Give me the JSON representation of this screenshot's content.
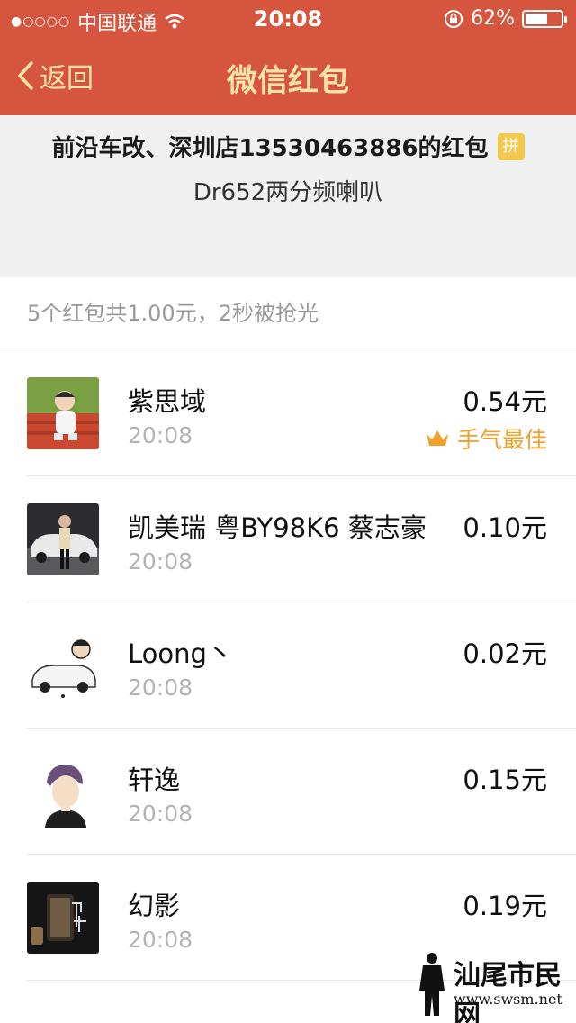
{
  "status_bar": {
    "carrier": "中国联通",
    "time": "20:08",
    "battery": "62%",
    "battery_level": 0.62
  },
  "nav": {
    "back_label": "返回",
    "title": "微信红包"
  },
  "header": {
    "sender": "前沿车改、深圳店13530463886的红包",
    "badge": "拼",
    "wish": "Dr652两分频喇叭"
  },
  "summary": "5个红包共1.00元，2秒被抢光",
  "best_label": "手气最佳",
  "entries": [
    {
      "name": "紫思域",
      "time": "20:08",
      "amount": "0.54元"
    },
    {
      "name": "凯美瑞 粤BY98K6 蔡志豪",
      "time": "20:08",
      "amount": "0.10元"
    },
    {
      "name": "Loong丶",
      "time": "20:08",
      "amount": "0.02元"
    },
    {
      "name": "轩逸",
      "time": "20:08",
      "amount": "0.15元"
    },
    {
      "name": "幻影",
      "time": "20:08",
      "amount": "0.19元"
    }
  ],
  "watermark": {
    "text": "汕尾市民网",
    "url": "www.swsm.net"
  },
  "colors": {
    "accent": "#d5553e",
    "title_gold": "#f7e2a8",
    "best_gold": "#f0a12a"
  }
}
